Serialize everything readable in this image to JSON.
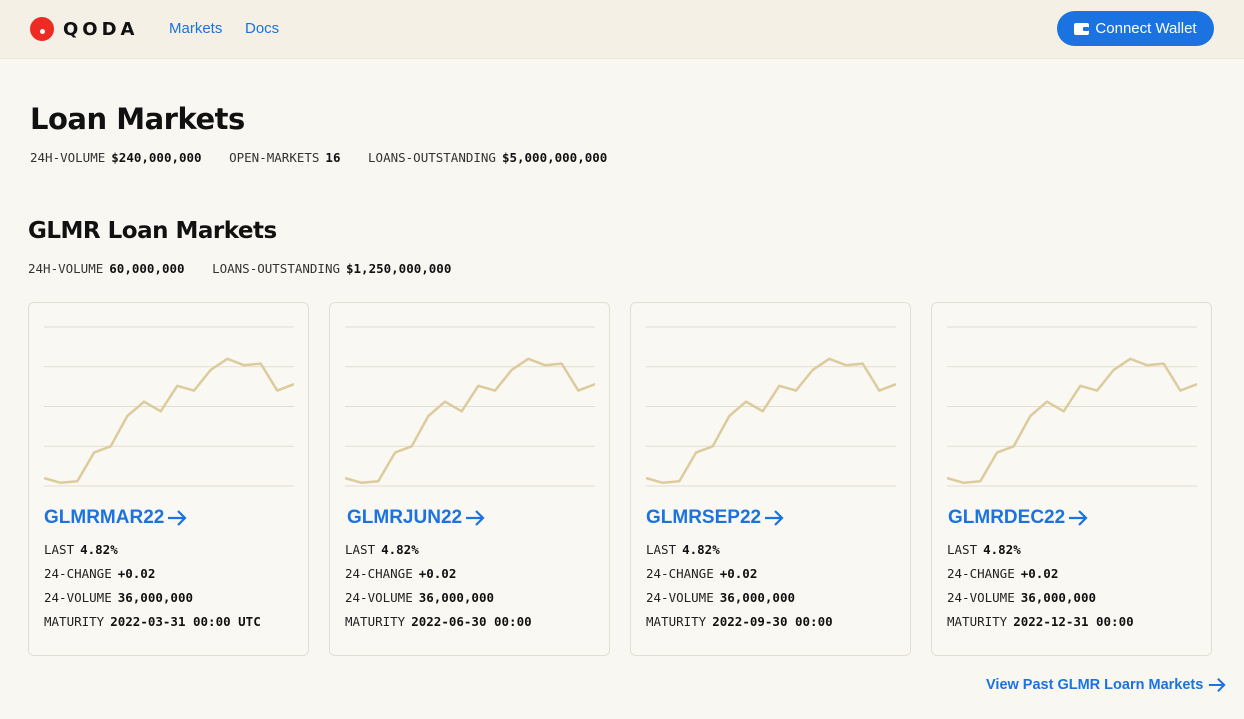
{
  "header": {
    "brand": "QODA",
    "nav": [
      "Markets",
      "Docs"
    ],
    "connect_label": "Connect Wallet"
  },
  "page": {
    "title": "Loan Markets",
    "stats": [
      {
        "label": "24H-VOLUME",
        "value": "$240,000,000"
      },
      {
        "label": "OPEN-MARKETS",
        "value": "16"
      },
      {
        "label": "LOANS-OUTSTANDING",
        "value": "$5,000,000,000"
      }
    ]
  },
  "section": {
    "title": "GLMR Loan Markets",
    "stats": [
      {
        "label": "24H-VOLUME",
        "value": "60,000,000"
      },
      {
        "label": "LOANS-OUTSTANDING",
        "value": "$1,250,000,000"
      }
    ]
  },
  "cards": [
    {
      "name": "GLMRMAR22",
      "last_label": "LAST",
      "last": "4.82%",
      "change_label": "24-CHANGE",
      "change": "+0.02",
      "volume_label": "24-VOLUME",
      "volume": "36,000,000",
      "maturity_label": "MATURITY",
      "maturity": "2022-03-31 00:00 UTC"
    },
    {
      "name": "GLMRJUN22",
      "last_label": "LAST",
      "last": "4.82%",
      "change_label": "24-CHANGE",
      "change": "+0.02",
      "volume_label": "24-VOLUME",
      "volume": "36,000,000",
      "maturity_label": "MATURITY",
      "maturity": "2022-06-30 00:00"
    },
    {
      "name": "GLMRSEP22",
      "last_label": "LAST",
      "last": "4.82%",
      "change_label": "24-CHANGE",
      "change": "+0.02",
      "volume_label": "24-VOLUME",
      "volume": "36,000,000",
      "maturity_label": "MATURITY",
      "maturity": "2022-09-30 00:00"
    },
    {
      "name": "GLMRDEC22",
      "last_label": "LAST",
      "last": "4.82%",
      "change_label": "24-CHANGE",
      "change": "+0.02",
      "volume_label": "24-VOLUME",
      "volume": "36,000,000",
      "maturity_label": "MATURITY",
      "maturity": "2022-12-31 00:00"
    }
  ],
  "sparkline": {
    "type": "line",
    "values": [
      0.05,
      0.02,
      0.03,
      0.21,
      0.25,
      0.44,
      0.53,
      0.47,
      0.63,
      0.6,
      0.73,
      0.8,
      0.76,
      0.77,
      0.6,
      0.64
    ],
    "color": "#dccb9c",
    "gridlines": 5
  },
  "colors": {
    "accent": "#1a73e0",
    "logo": "#ee2a24",
    "header_bg": "#f4f0e5",
    "page_bg": "#f9f7f2"
  },
  "footer": {
    "view_past": "View Past GLMR Loarn Markets"
  }
}
